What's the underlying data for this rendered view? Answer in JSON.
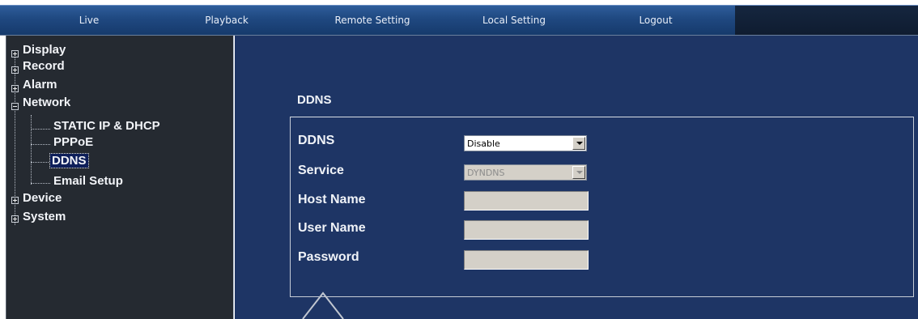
{
  "nav": {
    "tabs": [
      {
        "label": "Live"
      },
      {
        "label": "Playback"
      },
      {
        "label": "Remote Setting"
      },
      {
        "label": "Local Setting"
      },
      {
        "label": "Logout"
      }
    ]
  },
  "sidebar": {
    "items": [
      {
        "label": "Display",
        "expander": "plus"
      },
      {
        "label": "Record",
        "expander": "plus"
      },
      {
        "label": "Alarm",
        "expander": "plus"
      },
      {
        "label": "Network",
        "expander": "minus"
      },
      {
        "label": "STATIC IP & DHCP"
      },
      {
        "label": "PPPoE"
      },
      {
        "label": "DDNS",
        "selected": true
      },
      {
        "label": "Email Setup"
      },
      {
        "label": "Device",
        "expander": "plus"
      },
      {
        "label": "System",
        "expander": "plus"
      }
    ]
  },
  "ddns": {
    "section_title": "DDNS",
    "fields": {
      "ddns": {
        "label": "DDNS",
        "value": "Disable"
      },
      "service": {
        "label": "Service",
        "value": "DYNDNS"
      },
      "host_name": {
        "label": "Host Name",
        "value": ""
      },
      "user_name": {
        "label": "User Name",
        "value": ""
      },
      "password": {
        "label": "Password",
        "value": ""
      }
    }
  },
  "colors": {
    "main_bg": "#1e3565",
    "sidebar_bg": "#252a31",
    "topbar": "#1f4880"
  }
}
